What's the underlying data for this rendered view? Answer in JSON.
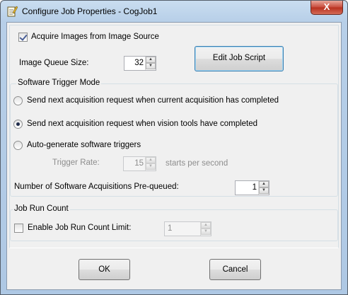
{
  "window": {
    "title": "Configure Job Properties - CogJob1",
    "close_glyph": "X"
  },
  "acquire": {
    "label": "Acquire Images from Image Source",
    "checked": true
  },
  "queue": {
    "label": "Image Queue Size:",
    "value": "32"
  },
  "edit_script": {
    "label": "Edit Job Script"
  },
  "trigger_mode": {
    "group_label": "Software Trigger Mode",
    "options": [
      {
        "label": "Send next acquisition request when current acquisition has completed",
        "selected": false
      },
      {
        "label": "Send next acquisition request when vision tools have completed",
        "selected": true
      },
      {
        "label": "Auto-generate software triggers",
        "selected": false
      }
    ],
    "trigger_rate": {
      "label": "Trigger Rate:",
      "value": "15",
      "units": "starts per second"
    },
    "prequeued": {
      "label": "Number of Software Acquisitions Pre-queued:",
      "value": "1"
    }
  },
  "run_count": {
    "group_label": "Job Run Count",
    "enable_label": "Enable Job Run Count Limit:",
    "enabled": false,
    "value": "1"
  },
  "buttons": {
    "ok": "OK",
    "cancel": "Cancel"
  },
  "spin_up_glyph": "▲",
  "spin_down_glyph": "▼"
}
